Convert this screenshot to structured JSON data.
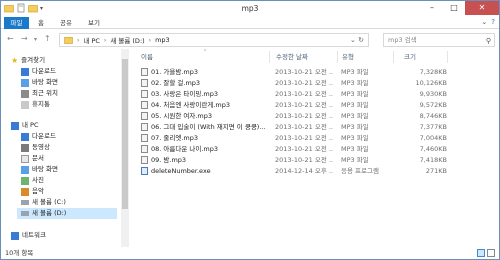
{
  "window": {
    "title": "mp3"
  },
  "ribbon": {
    "tabs": [
      "파일",
      "홈",
      "공유",
      "보기"
    ]
  },
  "address": {
    "crumbs": [
      "내 PC",
      "새 볼륨 (D:)",
      "mp3"
    ],
    "search_placeholder": "mp3 검색"
  },
  "nav": {
    "favorites_label": "즐겨찾기",
    "favorites": [
      "다운로드",
      "바탕 화면",
      "최근 위치",
      "휴지통"
    ],
    "pc_label": "내 PC",
    "pc_items": [
      "다운로드",
      "동영상",
      "문서",
      "바탕 화면",
      "사진",
      "음악",
      "새 볼륨 (C:)",
      "새 볼륨 (D:)"
    ],
    "network_label": "네트워크"
  },
  "columns": {
    "name": "이름",
    "date": "수정한 날짜",
    "type": "유형",
    "size": "크기"
  },
  "files": [
    {
      "name": "01. 가을밤.mp3",
      "date": "2013-10-21 오전 ...",
      "type": "MP3 파일",
      "size": "7,328KB"
    },
    {
      "name": "02. 잘할 걸.mp3",
      "date": "2013-10-21 오전 ...",
      "type": "MP3 파일",
      "size": "10,126KB"
    },
    {
      "name": "03. 사랑은 타이밍.mp3",
      "date": "2013-10-21 오전 ...",
      "type": "MP3 파일",
      "size": "9,930KB"
    },
    {
      "name": "04. 처음엔 사랑이란게.mp3",
      "date": "2013-10-21 오전 ...",
      "type": "MP3 파일",
      "size": "9,572KB"
    },
    {
      "name": "05. 시원한 여자.mp3",
      "date": "2013-10-21 오전 ...",
      "type": "MP3 파일",
      "size": "8,746KB"
    },
    {
      "name": "06. 그대 입술이 (With 재지면 이 쿵쿵)...",
      "date": "2013-10-21 오전 ...",
      "type": "MP3 파일",
      "size": "7,377KB"
    },
    {
      "name": "07. 줄리엣.mp3",
      "date": "2013-10-21 오전 ...",
      "type": "MP3 파일",
      "size": "7,004KB"
    },
    {
      "name": "08. 아름다운 나이.mp3",
      "date": "2013-10-21 오전 ...",
      "type": "MP3 파일",
      "size": "7,460KB"
    },
    {
      "name": "09. 밤.mp3",
      "date": "2013-10-21 오전 ...",
      "type": "MP3 파일",
      "size": "7,418KB"
    },
    {
      "name": "deleteNumber.exe",
      "date": "2014-12-14 오후 ...",
      "type": "응용 프로그램",
      "size": "271KB"
    }
  ],
  "status": {
    "count": "10개 항목"
  }
}
